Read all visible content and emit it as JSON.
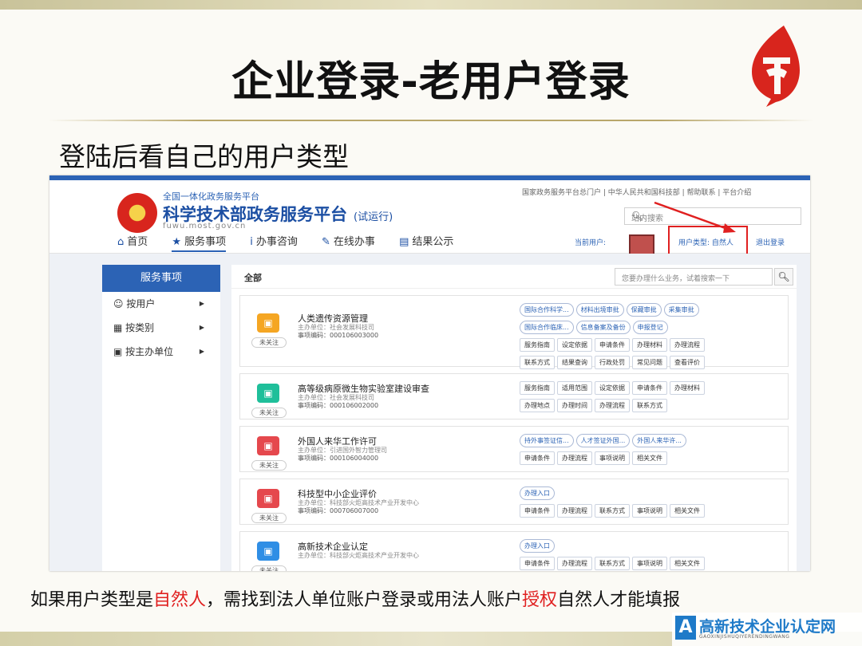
{
  "slide": {
    "title": "企业登录-老用户登录",
    "subtitle": "登陆后看自己的用户类型",
    "caption_parts": [
      "如果用户类型是",
      "自然人",
      "，需找到法人单位账户登录或用法人账户",
      "授权",
      "自然人才能填报"
    ],
    "watermark_title": "高新技术企业认定网",
    "watermark_sub": "GAOXINJISHUQIYERENDINGWANG"
  },
  "site": {
    "org_sub": "全国一体化政务服务平台",
    "org_main": "科学技术部政务服务平台",
    "org_tag": "(试运行)",
    "url": "fuwu.most.gov.cn",
    "top_links": "国家政务服务平台总门户 | 中华人民共和国科技部 | 帮助联系 | 平台介绍",
    "search_placeholder": "站内搜索",
    "nav": [
      "首页",
      "服务事项",
      "办事咨询",
      "在线办事",
      "结果公示"
    ],
    "current_user_label": "当前用户:",
    "user_type": "用户类型: 自然人",
    "logout": "退出登录"
  },
  "sidebar": {
    "header": "服务事项",
    "items": [
      "按用户",
      "按类别",
      "按主办单位"
    ]
  },
  "content": {
    "tab": "全部",
    "search_placeholder": "您要办理什么业务，试着搜索一下",
    "follow_label": "未关注",
    "items": [
      {
        "name": "人类遗传资源管理",
        "dept": "主办单位：社会发展科技司",
        "code": "事项编码：000106003000",
        "color": "#f5a623",
        "rows": [
          [
            "国际合作科学...",
            "材料出境审批",
            "保藏审批",
            "采集审批"
          ],
          [
            "国际合作临床...",
            "信息备案及备份",
            "申报登记"
          ],
          [
            "服务指南",
            "设定依据",
            "申请条件",
            "办理材料",
            "办理流程"
          ],
          [
            "联系方式",
            "结果查询",
            "行政处罚",
            "常见问题",
            "查看评价"
          ]
        ]
      },
      {
        "name": "高等级病原微生物实验室建设审查",
        "dept": "主办单位：社会发展科技司",
        "code": "事项编码：000106002000",
        "color": "#1fbf9a",
        "rows": [
          [
            "服务指南",
            "适用范围",
            "设定依据",
            "申请条件",
            "办理材料"
          ],
          [
            "办理地点",
            "办理时间",
            "办理流程",
            "联系方式"
          ]
        ]
      },
      {
        "name": "外国人来华工作许可",
        "dept": "主办单位：引进国外智力管理司",
        "code": "事项编码：000106004000",
        "color": "#e5484d",
        "rows": [
          [
            "持外事签证信...",
            "人才签证外国...",
            "外国人来华许..."
          ],
          [
            "申请条件",
            "办理流程",
            "事项说明",
            "相关文件"
          ]
        ]
      },
      {
        "name": "科技型中小企业评价",
        "dept": "主办单位：科技部火炬高技术产业开发中心",
        "code": "事项编码：000706007000",
        "color": "#e5484d",
        "rows": [
          [
            "办理入口"
          ],
          [
            "申请条件",
            "办理流程",
            "联系方式",
            "事项说明",
            "相关文件"
          ]
        ]
      },
      {
        "name": "高新技术企业认定",
        "dept": "主办单位：科技部火炬高技术产业开发中心",
        "code": "",
        "color": "#2f8ee5",
        "rows": [
          [
            "办理入口"
          ],
          [
            "申请条件",
            "办理流程",
            "联系方式",
            "事项说明",
            "相关文件"
          ]
        ]
      }
    ]
  }
}
